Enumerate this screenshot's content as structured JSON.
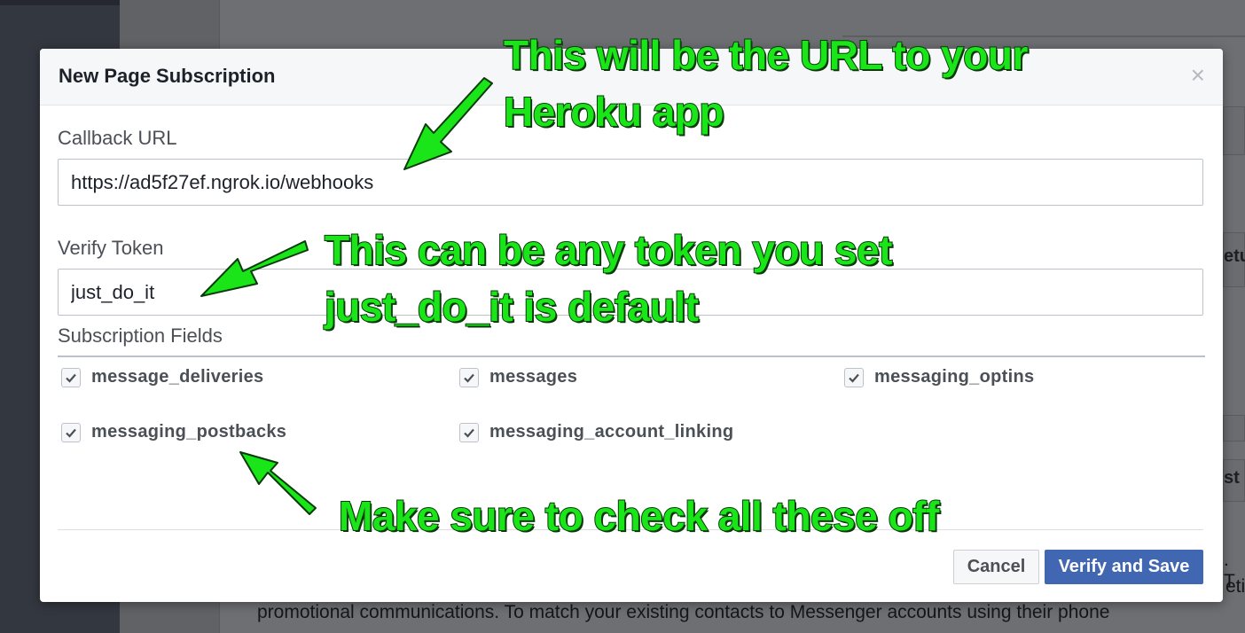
{
  "background": {
    "paragraph": "promotional communications. To match your existing contacts to Messenger accounts using their phone",
    "right_frag_1": "etu",
    "right_frag_2": "st",
    "right_frag_3": ". T",
    "right_frag_4": "etin"
  },
  "modal": {
    "title": "New Page Subscription",
    "close_glyph": "×",
    "callback": {
      "label": "Callback URL",
      "value": "https://ad5f27ef.ngrok.io/webhooks"
    },
    "verify": {
      "label": "Verify Token",
      "value": "just_do_it"
    },
    "fields": {
      "label": "Subscription Fields",
      "items": [
        {
          "label": "message_deliveries",
          "checked": true
        },
        {
          "label": "messages",
          "checked": true
        },
        {
          "label": "messaging_optins",
          "checked": true
        },
        {
          "label": "messaging_postbacks",
          "checked": true
        },
        {
          "label": "messaging_account_linking",
          "checked": true
        }
      ]
    },
    "buttons": {
      "cancel": "Cancel",
      "verify_save": "Verify and Save"
    }
  },
  "annotations": {
    "url_line1": "This will be the URL to your",
    "url_line2": "Heroku app",
    "token_line1": "This can be any token you set",
    "token_line2": "just_do_it is default",
    "fields_note": "Make sure to check all these off"
  },
  "colors": {
    "primary_button": "#4267b2",
    "annotation_green": "#19e519",
    "annotation_outline": "#0a3a0a"
  }
}
